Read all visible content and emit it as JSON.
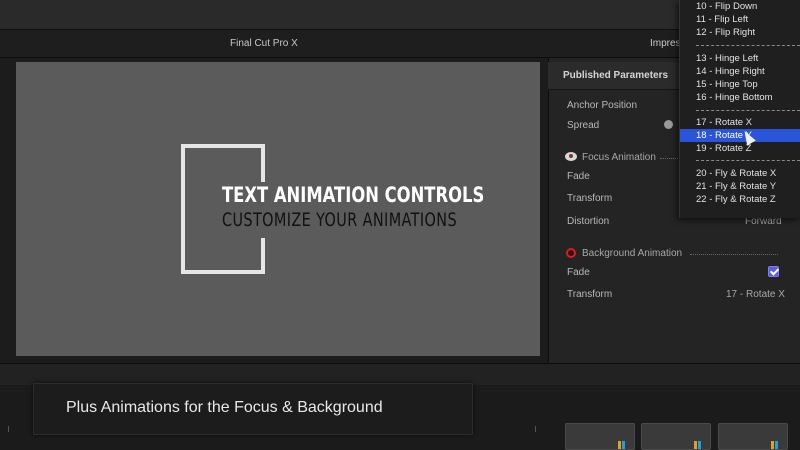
{
  "window": {
    "app_title": "Final Cut Pro X",
    "inspector_title": "Impressive"
  },
  "viewer": {
    "headline": "TEXT ANIMATION CONTROLS",
    "subline": "CUSTOMIZE YOUR ANIMATIONS"
  },
  "inspector": {
    "header": "Published Parameters",
    "rows": {
      "anchor_position": "Anchor Position",
      "spread": "Spread",
      "focus_section": "Focus Animation",
      "focus_fade": "Fade",
      "focus_transform": "Transform",
      "focus_distortion": "Distortion",
      "focus_distortion_value": "Forward",
      "background_section": "Background Animation",
      "bg_fade": "Fade",
      "bg_fade_checked": true,
      "bg_transform": "Transform",
      "bg_transform_value": "17 - Rotate X"
    }
  },
  "dropdown": {
    "items": [
      "10 - Flip Down",
      "11 - Flip Left",
      "12 - Flip Right",
      "13 - Hinge Left",
      "14 - Hinge Right",
      "15 - Hinge Top",
      "16 - Hinge Bottom",
      "17 - Rotate X",
      "18 - Rotate Y",
      "19 - Rotate Z",
      "20 - Fly & Rotate X",
      "21 - Fly & Rotate Y",
      "22 - Fly & Rotate Z"
    ],
    "selected": "18 - Rotate Y"
  },
  "caption": {
    "text": "Plus Animations for the Focus & Background"
  },
  "colors": {
    "selection": "#2a55d8",
    "checkbox": "#5b5fe0",
    "record": "#d22020"
  }
}
